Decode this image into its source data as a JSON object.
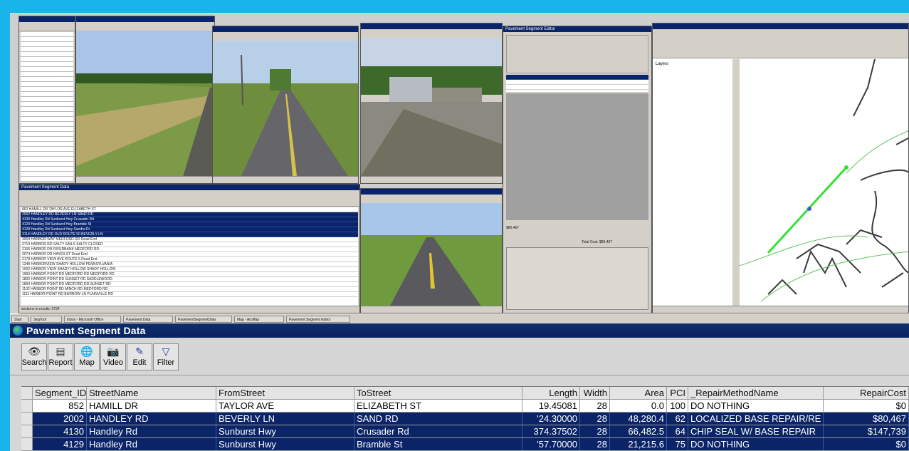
{
  "window": {
    "title": "Pavement Segment Data"
  },
  "toolbar": {
    "buttons": [
      {
        "label": "Search",
        "icon": "binoculars-icon",
        "glyph": "👁"
      },
      {
        "label": "Report",
        "icon": "report-icon",
        "glyph": "▤"
      },
      {
        "label": "Map",
        "icon": "globe-icon",
        "glyph": "🌐"
      },
      {
        "label": "Video",
        "icon": "camera-icon",
        "glyph": "📷"
      },
      {
        "label": "Edit",
        "icon": "edit-icon",
        "glyph": "✎"
      },
      {
        "label": "Filter",
        "icon": "filter-icon",
        "glyph": "▽"
      }
    ]
  },
  "table": {
    "columns": [
      "Segment_ID",
      "StreetName",
      "FromStreet",
      "ToStreet",
      "Length",
      "Width",
      "Area",
      "PCI",
      "_RepairMethodName",
      "RepairCost"
    ],
    "rows": [
      {
        "selected": false,
        "cells": [
          "852",
          "HAMILL DR",
          "TAYLOR AVE",
          "ELIZABETH ST",
          "19.45081",
          "28",
          "0.0",
          "100",
          "DO NOTHING",
          "$0"
        ]
      },
      {
        "selected": true,
        "cells": [
          "2002",
          "HANDLEY RD",
          "BEVERLY LN",
          "SAND RD",
          "'24.30000",
          "28",
          "48,280.4",
          "62",
          "LOCALIZED BASE REPAIR/RE",
          "$80,467"
        ]
      },
      {
        "selected": true,
        "cells": [
          "4130",
          "Handley Rd",
          "Sunburst Hwy",
          "Crusader Rd",
          "374.37502",
          "28",
          "66,482.5",
          "64",
          "CHIP SEAL W/ BASE REPAIR",
          "$147,739"
        ]
      },
      {
        "selected": true,
        "cells": [
          "4129",
          "Handley Rd",
          "Sunburst Hwy",
          "Bramble St",
          "'57.70000",
          "28",
          "21,215.6",
          "75",
          "DO NOTHING",
          "$0"
        ]
      }
    ]
  },
  "background": {
    "left_table_title": "Pavement Segment Data",
    "editor_title": "Pavement Segment Editor",
    "editor_repair_cost": "$80,467",
    "editor_total_cost": "Total Cost: $80,467",
    "map_title": "Layers",
    "status_left": "sections in results: 2794",
    "taskbar_items": [
      "Start",
      "SegTool",
      "Inbox - Microsoft Office",
      "Pavement Data",
      "PavementSegmentData",
      "Map - ArcMap",
      "Pavement Segment Editor"
    ],
    "mini_rows_left": [
      {
        "sel": false,
        "t": "852 HAMILL DR   TAYLOR AVE   ELIZABETH ST"
      },
      {
        "sel": true,
        "t": "2002 HANDLEY RD   BEVERLY LN   SAND RD"
      },
      {
        "sel": true,
        "t": "4130 Handley Rd   Sunburst Hwy   Crusader Rd"
      },
      {
        "sel": true,
        "t": "4129 Handley Rd   Sunburst Hwy   Bramble St"
      },
      {
        "sel": true,
        "t": "4128 Handley Rd   Sunburst Hwy   Sandra Dr"
      },
      {
        "sel": true,
        "t": "3114 HANDLEY RD   OLD ROUTE 50   BEVERLY LN"
      },
      {
        "sel": false,
        "t": "3004 HARBOR WAY   MEDFORD RD   Dead End"
      },
      {
        "sel": false,
        "t": "2710 HARBOR RD   SALTY SAILS   SALTY CLOSED"
      },
      {
        "sel": false,
        "t": "2106 HARBOR DR   RIVERBANK   MEDFORD RD"
      },
      {
        "sel": false,
        "t": "2074 HARBOR DR   HAYES ST   Dead End"
      },
      {
        "sel": false,
        "t": "2178 HARBOR VIEW AVE   ROUTE 5   Dead End"
      },
      {
        "sel": false,
        "t": "1248 HARBORVIEW   SHADY HOLLOW   PENNSYLVANIA"
      },
      {
        "sel": false,
        "t": "1002 HARBOR VIEW   SHADY HOLLOW   SHADY HOLLOW"
      },
      {
        "sel": false,
        "t": "1960 HARBOR POINT RD   MEDFORD RD   MEDFORD RD"
      },
      {
        "sel": false,
        "t": "1802 HARBOR POINT RD   SUNSET RD   SADDLEWOOD"
      },
      {
        "sel": false,
        "t": "1800 HARBOR POINT RD   MEDFORD RD   SUNSET RD"
      },
      {
        "sel": false,
        "t": "1102 HARBOR POINT RD   MINCH RD   MEDFORD RD"
      },
      {
        "sel": false,
        "t": "1111 HARBOR POINT RD   BURROW LN   PLAINVILLE RD"
      }
    ]
  }
}
